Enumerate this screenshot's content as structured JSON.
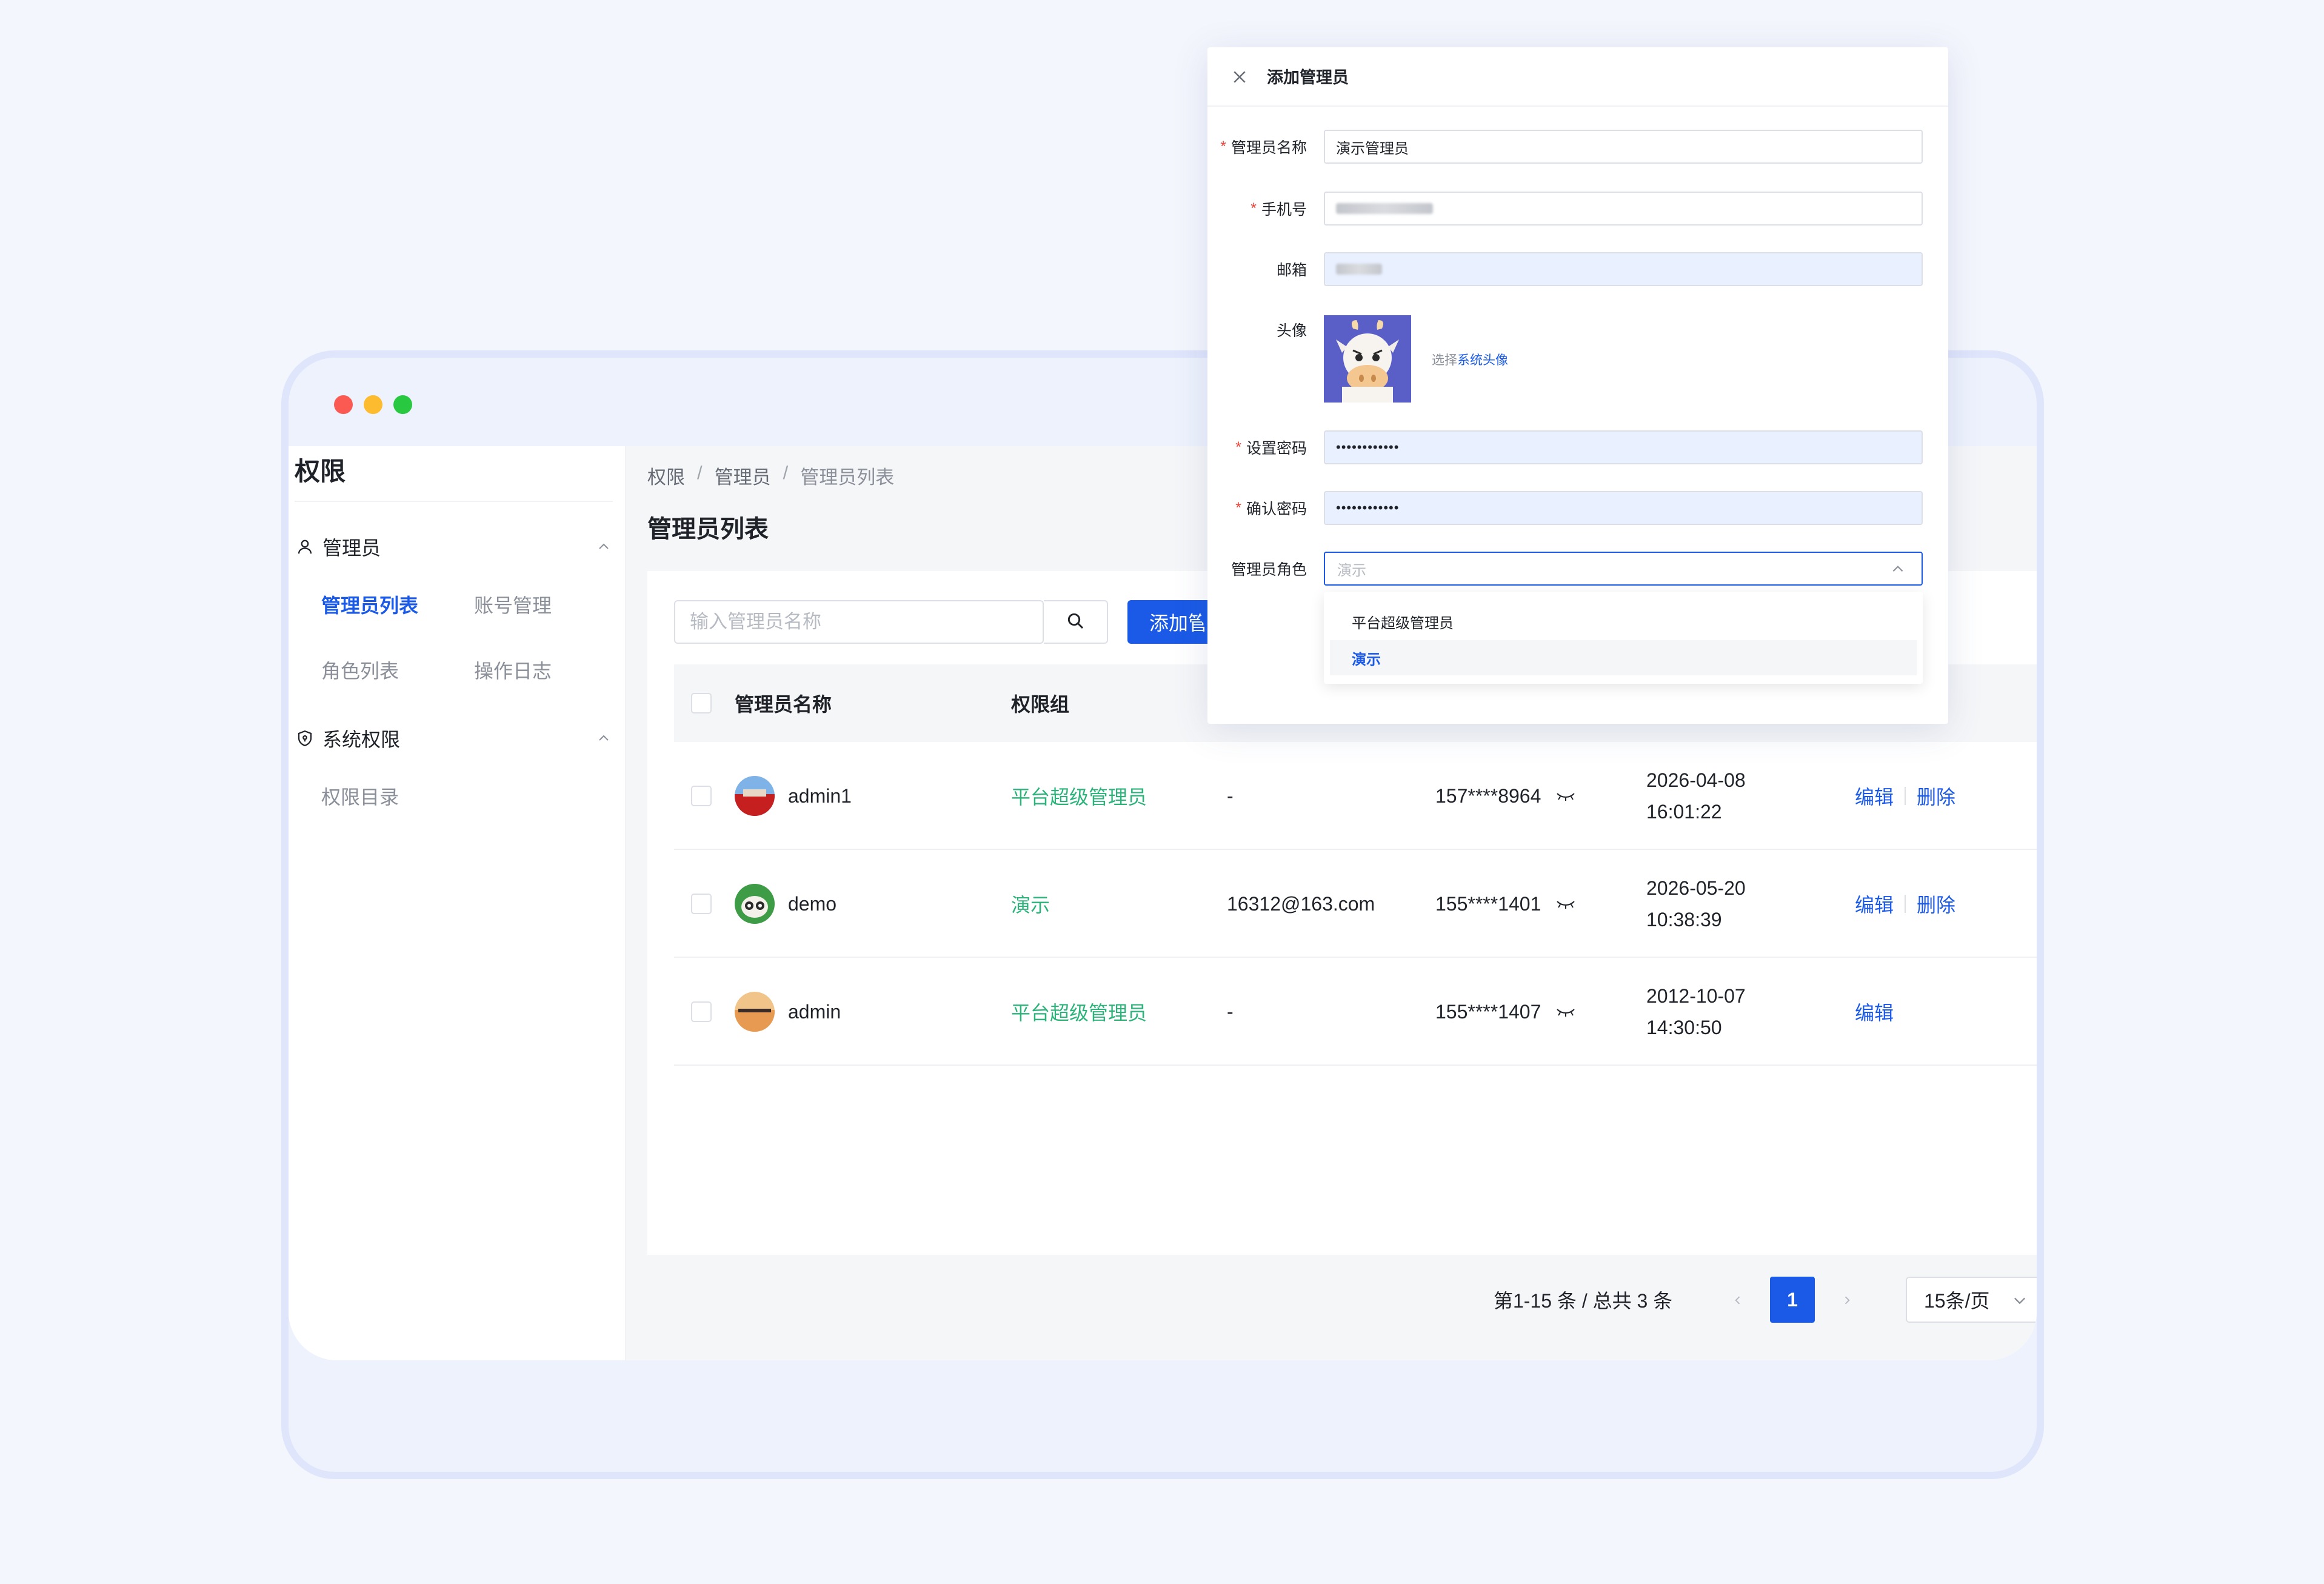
{
  "sidebar": {
    "title": "权限",
    "groups": [
      {
        "label": "管理员",
        "icon": "user-icon"
      },
      {
        "label": "系统权限",
        "icon": "shield-icon"
      }
    ],
    "items": [
      "管理员列表",
      "账号管理",
      "角色列表",
      "操作日志",
      "权限目录"
    ],
    "active_item": "管理员列表"
  },
  "breadcrumb": [
    "权限",
    "管理员",
    "管理员列表"
  ],
  "breadcrumb_sep": "/",
  "page_title": "管理员列表",
  "search": {
    "placeholder": "输入管理员名称",
    "icon": "search-icon"
  },
  "add_button": "添加管理员",
  "table": {
    "columns": [
      "管理员名称",
      "权限组"
    ],
    "rows": [
      {
        "name": "admin1",
        "role": "平台超级管理员",
        "email": "-",
        "phone": "157****8964",
        "date": "2026-04-08",
        "time": "16:01:22",
        "actions": [
          "编辑",
          "删除"
        ]
      },
      {
        "name": "demo",
        "role": "演示",
        "email": "16312@163.com",
        "phone": "155****1401",
        "date": "2026-05-20",
        "time": "10:38:39",
        "actions": [
          "编辑",
          "删除"
        ]
      },
      {
        "name": "admin",
        "role": "平台超级管理员",
        "email": "-",
        "phone": "155****1407",
        "date": "2012-10-07",
        "time": "14:30:50",
        "actions": [
          "编辑"
        ]
      }
    ]
  },
  "pagination": {
    "total_text": "第1-15 条 / 总共 3 条",
    "current_page": "1",
    "page_size": "15条/页"
  },
  "modal": {
    "title": "添加管理员",
    "fields": {
      "name_label": "管理员名称",
      "name_value": "演示管理员",
      "phone_label": "手机号",
      "email_label": "邮箱",
      "avatar_label": "头像",
      "avatar_pick_prefix": "选择",
      "avatar_pick_link": "系统头像",
      "password_label": "设置密码",
      "password_value": "••••••••••••",
      "confirm_label": "确认密码",
      "confirm_value": "••••••••••••",
      "role_label": "管理员角色",
      "role_value": "演示"
    },
    "required_mark": "*",
    "role_options": [
      "平台超级管理员",
      "演示"
    ],
    "selected_option": "演示"
  },
  "colors": {
    "primary": "#1a5ae6",
    "role_text": "#2bb37a",
    "danger": "#f04438"
  }
}
